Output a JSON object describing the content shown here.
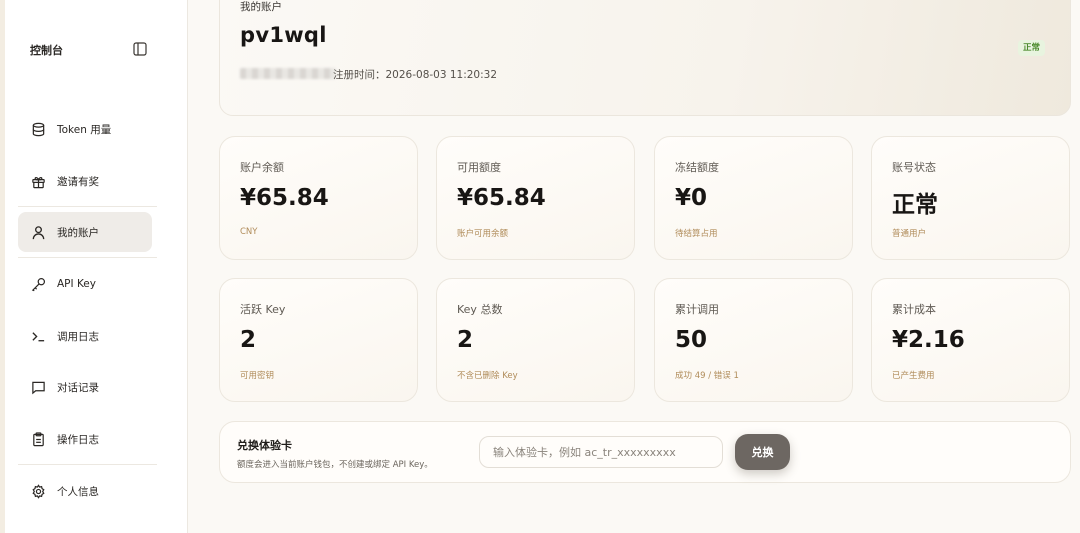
{
  "sidebar": {
    "title": "控制台",
    "items": [
      {
        "label": "Token 用量",
        "icon": "database-icon"
      },
      {
        "label": "邀请有奖",
        "icon": "gift-icon"
      },
      {
        "label": "我的账户",
        "icon": "user-icon",
        "active": true
      },
      {
        "label": "API Key",
        "icon": "key-icon"
      },
      {
        "label": "调用日志",
        "icon": "terminal-icon"
      },
      {
        "label": "对话记录",
        "icon": "message-icon"
      },
      {
        "label": "操作日志",
        "icon": "clipboard-icon"
      },
      {
        "label": "个人信息",
        "icon": "gear-icon"
      }
    ]
  },
  "account": {
    "section_label": "我的账户",
    "username": "pv1wql",
    "registered": "注册时间：2026-08-03 11:20:32",
    "status": "正常"
  },
  "stats": [
    {
      "label": "账户余额",
      "value": "¥65.84",
      "sub": "CNY"
    },
    {
      "label": "可用额度",
      "value": "¥65.84",
      "sub": "账户可用余额"
    },
    {
      "label": "冻结额度",
      "value": "¥0",
      "sub": "待结算占用"
    },
    {
      "label": "账号状态",
      "value": "正常",
      "sub": "普通用户"
    },
    {
      "label": "活跃 Key",
      "value": "2",
      "sub": "可用密钥"
    },
    {
      "label": "Key 总数",
      "value": "2",
      "sub": "不含已删除 Key"
    },
    {
      "label": "累计调用",
      "value": "50",
      "sub": "成功 49 / 错误 1"
    },
    {
      "label": "累计成本",
      "value": "¥2.16",
      "sub": "已产生费用"
    }
  ],
  "redeem": {
    "title": "兑换体验卡",
    "desc": "额度会进入当前账户钱包，不创建或绑定 API Key。",
    "placeholder": "输入体验卡，例如 ac_tr_xxxxxxxxx",
    "button": "兑换"
  },
  "colors": {
    "status_bg": "#e8f4df",
    "status_text": "#4a8a2c",
    "sub_text": "#b08c5a",
    "button_bg": "#6d6762"
  }
}
